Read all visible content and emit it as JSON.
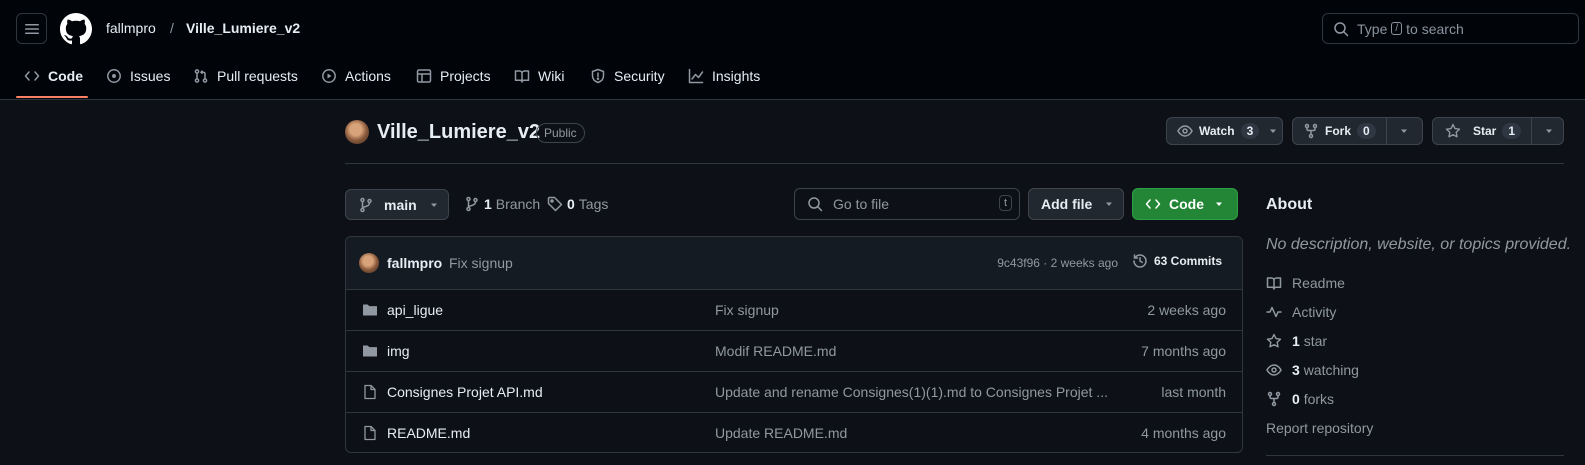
{
  "header": {
    "owner": "fallmpro",
    "separator": "/",
    "repo": "Ville_Lumiere_v2",
    "search": {
      "prefix": "Type",
      "key": "/",
      "suffix": "to search"
    }
  },
  "nav": {
    "tabs": [
      {
        "label": "Code",
        "icon": "code-icon",
        "active": true
      },
      {
        "label": "Issues",
        "icon": "issue-icon"
      },
      {
        "label": "Pull requests",
        "icon": "pull-request-icon"
      },
      {
        "label": "Actions",
        "icon": "play-icon"
      },
      {
        "label": "Projects",
        "icon": "table-icon"
      },
      {
        "label": "Wiki",
        "icon": "book-icon"
      },
      {
        "label": "Security",
        "icon": "shield-icon"
      },
      {
        "label": "Insights",
        "icon": "graph-icon"
      }
    ]
  },
  "repo": {
    "name": "Ville_Lumiere_v2",
    "visibility": "Public",
    "watch": {
      "label": "Watch",
      "count": "3"
    },
    "fork": {
      "label": "Fork",
      "count": "0"
    },
    "star": {
      "label": "Star",
      "count": "1"
    }
  },
  "toolbar": {
    "branch": "main",
    "branches_count": "1",
    "branches_label": "Branch",
    "tags_count": "0",
    "tags_label": "Tags",
    "go_to_file": "Go to file",
    "go_to_file_key": "t",
    "add_file": "Add file",
    "code": "Code"
  },
  "latest_commit": {
    "author": "fallmpro",
    "message": "Fix signup",
    "meta": "9c43f96 · 2 weeks ago",
    "commits_count": "63 Commits"
  },
  "files": [
    {
      "name": "api_ligue",
      "type": "folder",
      "message": "Fix signup",
      "time": "2 weeks ago"
    },
    {
      "name": "img",
      "type": "folder",
      "message": "Modif README.md",
      "time": "7 months ago"
    },
    {
      "name": "Consignes Projet API.md",
      "type": "file",
      "message": "Update and rename Consignes(1)(1).md to Consignes Projet ...",
      "time": "last month"
    },
    {
      "name": "README.md",
      "type": "file",
      "message": "Update README.md",
      "time": "4 months ago"
    }
  ],
  "about": {
    "title": "About",
    "description": "No description, website, or topics provided.",
    "readme": "Readme",
    "activity": "Activity",
    "stars_count": "1",
    "stars_label": "star",
    "watching_count": "3",
    "watching_label": "watching",
    "forks_count": "0",
    "forks_label": "forks",
    "report": "Report repository"
  },
  "colors": {
    "background": "#0d1117",
    "header_bg": "#010409",
    "active_tab_underline": "#f78166",
    "code_button": "#238636",
    "muted_text": "#9198a1"
  }
}
